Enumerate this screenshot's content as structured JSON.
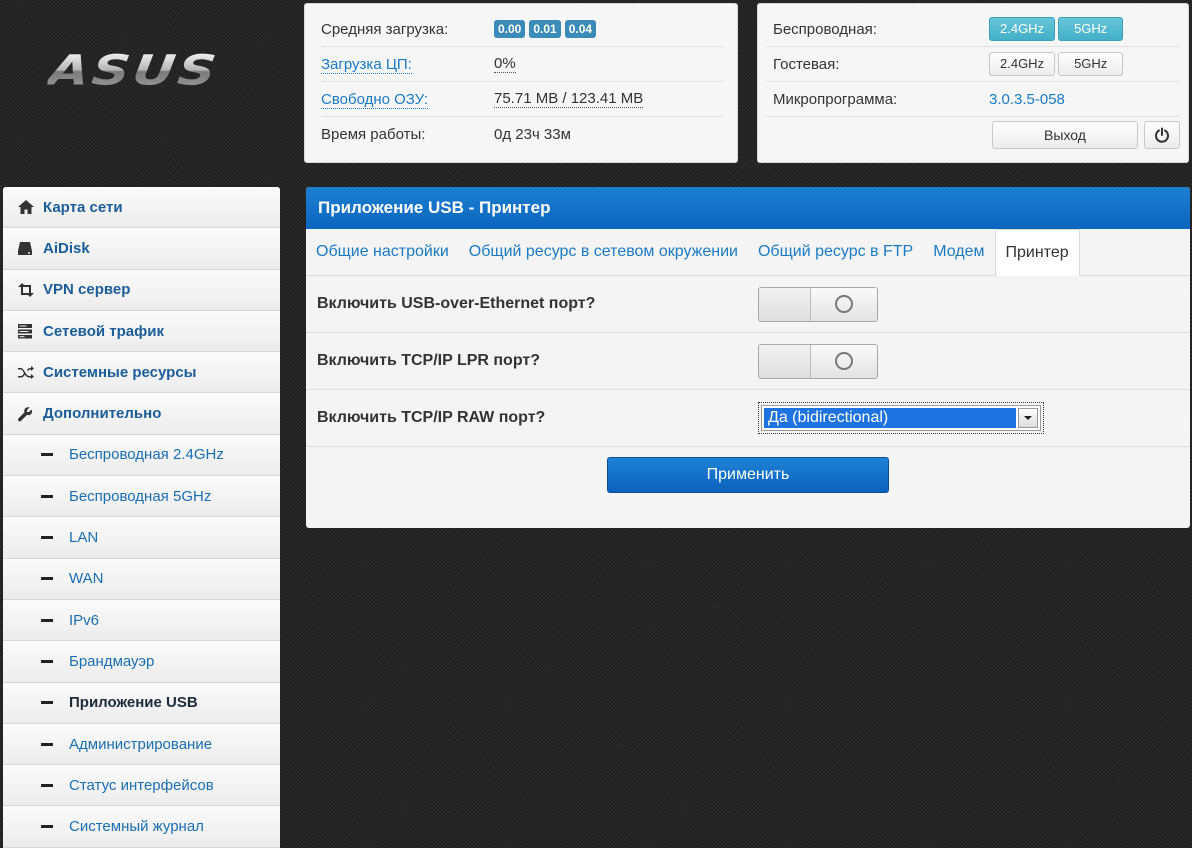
{
  "brand": {
    "logo_text": "ASUS"
  },
  "status": {
    "load_label": "Средняя загрузка:",
    "load_values": [
      "0.00",
      "0.01",
      "0.04"
    ],
    "cpu_label": "Загрузка ЦП:",
    "cpu_value": "0%",
    "ram_label": "Свободно ОЗУ:",
    "ram_value": "75.71 MB / 123.41 MB",
    "uptime_label": "Время работы:",
    "uptime_value": "0д 23ч 33м"
  },
  "wireless": {
    "wireless_label": "Беспроводная:",
    "wireless_btn_24": "2.4GHz",
    "wireless_btn_5": "5GHz",
    "guest_label": "Гостевая:",
    "guest_btn_24": "2.4GHz",
    "guest_btn_5": "5GHz",
    "firmware_label": "Микропрограмма:",
    "firmware_value": "3.0.3.5-058",
    "exit_label": "Выход",
    "active_color": "#43afc8"
  },
  "sidebar": {
    "items": [
      {
        "label": "Карта сети",
        "icon": "home-icon"
      },
      {
        "label": "AiDisk",
        "icon": "hdd-icon"
      },
      {
        "label": "VPN сервер",
        "icon": "retweet-icon"
      },
      {
        "label": "Сетевой трафик",
        "icon": "tasks-icon"
      },
      {
        "label": "Системные ресурсы",
        "icon": "random-icon"
      },
      {
        "label": "Дополнительно",
        "icon": "wrench-icon"
      }
    ],
    "subitems": [
      "Беспроводная 2.4GHz",
      "Беспроводная 5GHz",
      "LAN",
      "WAN",
      "IPv6",
      "Брандмауэр",
      "Приложение USB",
      "Администрирование",
      "Статус интерфейсов",
      "Системный журнал"
    ],
    "active_subitem": "Приложение USB"
  },
  "main": {
    "title": "Приложение USB - Принтер",
    "tabs": [
      "Общие настройки",
      "Общий ресурс в сетевом окружении",
      "Общий ресурс в FTP",
      "Модем",
      "Принтер"
    ],
    "active_tab": "Принтер",
    "fields": {
      "usb_over_eth_label": "Включить USB-over-Ethernet порт?",
      "usb_over_eth_enabled": false,
      "lpr_label": "Включить TCP/IP LPR порт?",
      "lpr_enabled": false,
      "raw_label": "Включить TCP/IP RAW порт?",
      "raw_value": "Да (bidirectional)"
    },
    "apply_label": "Применить",
    "header_color": "#0b66bf"
  }
}
